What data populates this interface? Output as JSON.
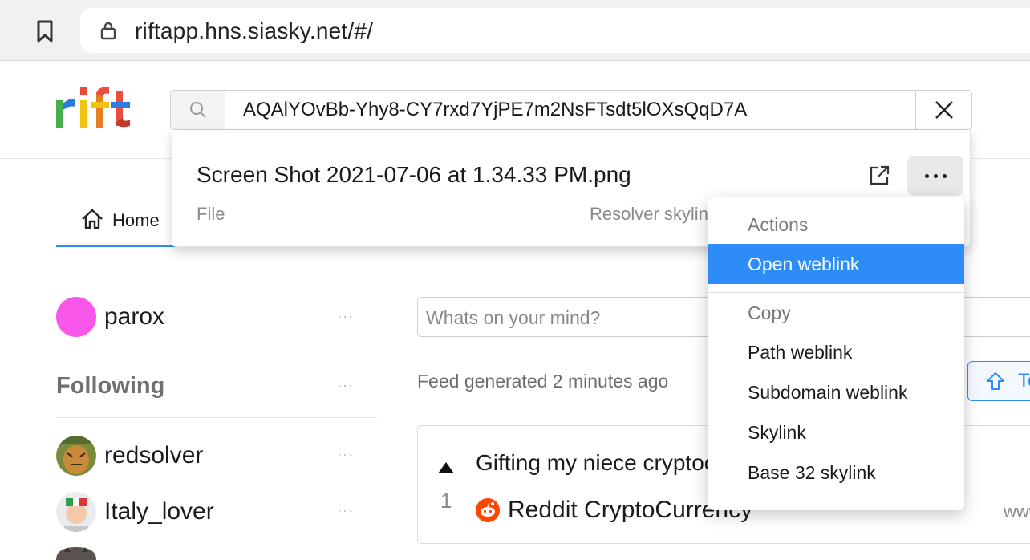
{
  "browser": {
    "url": "riftapp.hns.siasky.net/#/"
  },
  "header": {
    "logo_text": "rift",
    "search": {
      "value": "AQAlYOvBb-Yhy8-CY7rxd7YjPE7m2NsFTsdt5lOXsQqD7A"
    }
  },
  "result": {
    "title": "Screen Shot 2021-07-06 at 1.34.33 PM.png",
    "type": "File",
    "resolver": "Resolver skylink"
  },
  "menu": {
    "actions_header": "Actions",
    "open_weblink": "Open weblink",
    "copy_header": "Copy",
    "items": [
      "Path weblink",
      "Subdomain weblink",
      "Skylink",
      "Base 32 skylink"
    ]
  },
  "nav": {
    "home": "Home"
  },
  "sidebar": {
    "profile_name": "parox",
    "following_label": "Following",
    "dots": "···",
    "users": [
      "redsolver",
      "Italy_lover"
    ]
  },
  "feed": {
    "input_placeholder": "Whats on your mind?",
    "generated": "Feed generated 2 minutes ago",
    "upload_label": "To",
    "post": {
      "title": "Gifting my niece cryptocurrency",
      "votes": "1",
      "source": "Reddit CryptoCurrency",
      "link": "www"
    }
  },
  "colors": {
    "accent": "#2d8cf7",
    "avatar": "#f857ea"
  }
}
